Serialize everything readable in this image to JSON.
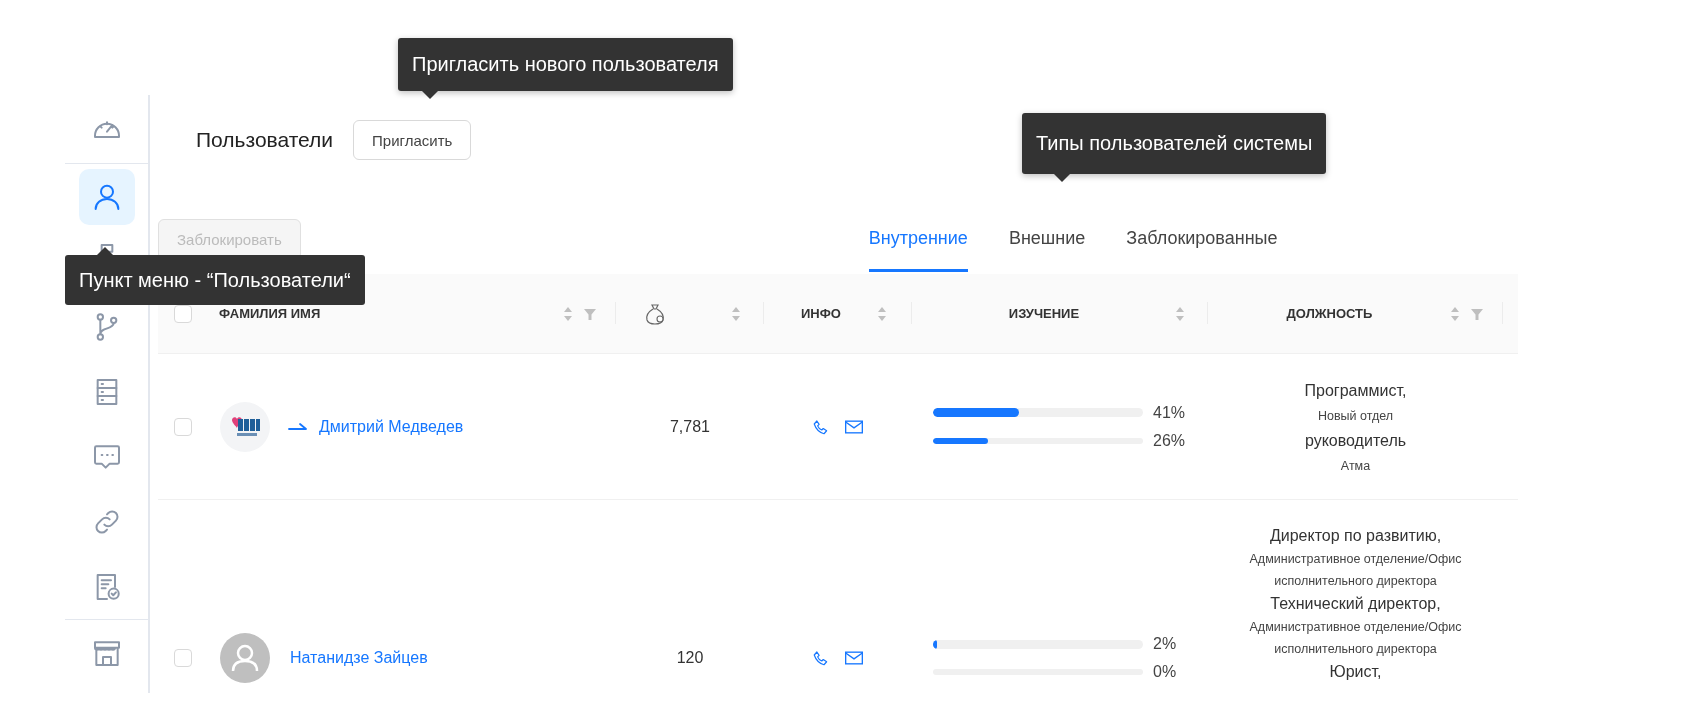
{
  "sidebar": {
    "items": [
      {
        "selected": false
      },
      {
        "selected": true
      },
      {
        "selected": false
      },
      {
        "selected": false
      },
      {
        "selected": false
      },
      {
        "selected": false
      },
      {
        "selected": false
      },
      {
        "selected": false
      },
      {
        "selected": false
      }
    ]
  },
  "header": {
    "title": "Пользователи",
    "invite_button": "Пригласить"
  },
  "toolbar": {
    "block_button": {
      "label": "Заблокировать",
      "disabled": true
    }
  },
  "tabs": [
    {
      "label": "Внутренние",
      "selected": true
    },
    {
      "label": "Внешние",
      "selected": false
    },
    {
      "label": "Заблокированные",
      "selected": false
    }
  ],
  "table": {
    "select_all": {
      "checked": false
    },
    "columns": [
      {
        "kind": "text",
        "label": "ФАМИЛИЯ ИМЯ",
        "sortable": true,
        "filterable": true
      },
      {
        "kind": "icon",
        "sortable": true
      },
      {
        "kind": "text",
        "label": "ИНФО",
        "sortable": true
      },
      {
        "kind": "text",
        "label": "ИЗУЧЕНИЕ",
        "sortable": true
      },
      {
        "kind": "text",
        "label": "ДОЛЖНОСТЬ",
        "sortable": true,
        "filterable": true
      }
    ],
    "rows": [
      {
        "checked": false,
        "avatar": {
          "kind": "picture"
        },
        "arrow": true,
        "name": "Дмитрий Медведев",
        "value": "7,781",
        "phone": true,
        "email": true,
        "progress": [
          {
            "level": 0.41,
            "reading": "41%"
          },
          {
            "level": 0.26,
            "reading": "26%"
          }
        ],
        "positions": [
          {
            "title": "Программист,",
            "department": "Новый отдел"
          },
          {
            "title": "руководитель",
            "department": "Атма"
          }
        ]
      },
      {
        "checked": false,
        "avatar": {
          "kind": "placeholder"
        },
        "name": "Натанидзе Зайцев",
        "value": "120",
        "phone": true,
        "email": true,
        "progress": [
          {
            "level": 0.02,
            "reading": "2%"
          },
          {
            "level": 0,
            "reading": "0%"
          }
        ],
        "positions": [
          {
            "title": "Директор по развитию,",
            "department": "Административное отделение/Офис исполнительного директора"
          },
          {
            "title": "Технический директор,",
            "department": "Административное отделение/Офис исполнительного директора"
          },
          {
            "title": "Юрист,"
          }
        ]
      }
    ]
  },
  "tooltips": [
    {
      "text": "Пригласить нового пользователя"
    },
    {
      "text": "Типы пользователей системы"
    },
    {
      "text": "Пункт меню - “Пользователи“"
    }
  ]
}
